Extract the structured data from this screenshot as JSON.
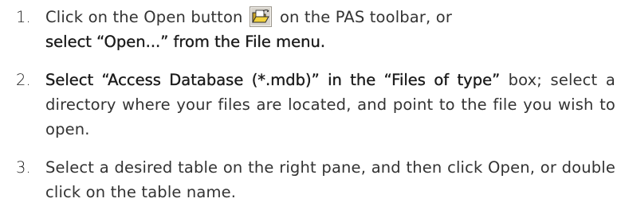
{
  "steps": [
    {
      "number": "1.",
      "before_icon": "Click on the Open button",
      "icon": "open-folder-icon",
      "after_icon": "on the PAS toolbar, or",
      "bold_tail": "select “Open...” from the File menu."
    },
    {
      "number": "2.",
      "bold_head": "Select “Access Database (*.mdb)” in the “Files of type”",
      "rest": "box; select a directory where your files are located, and point to the file you wish to open."
    },
    {
      "number": "3.",
      "text": "Select a desired table on the right pane, and then click Open, or double click on the table name."
    }
  ]
}
